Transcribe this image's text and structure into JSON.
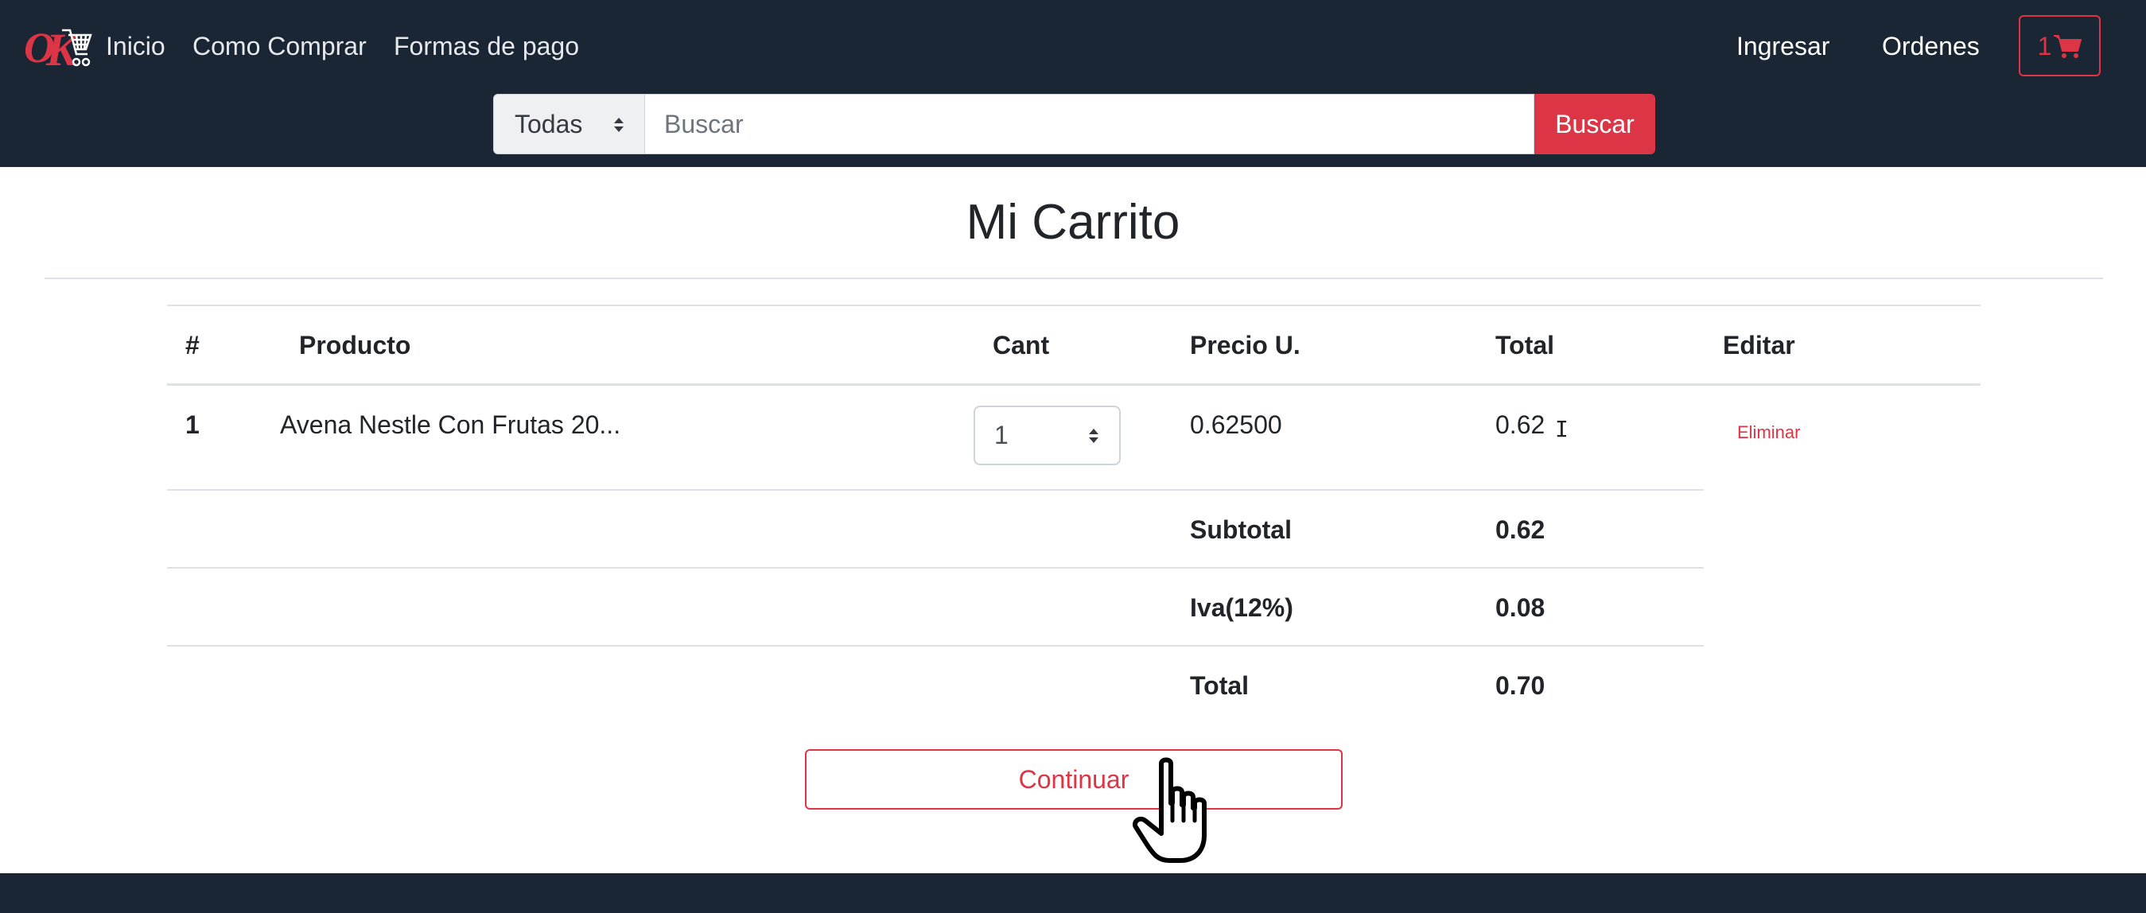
{
  "navbar": {
    "links": [
      "Inicio",
      "Como Comprar",
      "Formas de pago"
    ],
    "right_links": [
      "Ingresar",
      "Ordenes"
    ],
    "cart_count": "1",
    "colors": {
      "background": "#1b2635",
      "accent": "#dc3545"
    }
  },
  "search": {
    "category_selected": "Todas",
    "placeholder": "Buscar",
    "button_label": "Buscar"
  },
  "page": {
    "title": "Mi Carrito"
  },
  "table": {
    "headers": [
      "#",
      "Producto",
      "Cant",
      "Precio U.",
      "Total",
      "Editar"
    ],
    "rows": [
      {
        "index": "1",
        "product": "Avena Nestle Con Frutas 20...",
        "qty": "1",
        "unit_price": "0.62500",
        "total": "0.62",
        "action": "Eliminar"
      }
    ],
    "summary": [
      {
        "label": "Subtotal",
        "value": "0.62"
      },
      {
        "label": "Iva(12%)",
        "value": "0.08"
      },
      {
        "label": "Total",
        "value": "0.70"
      }
    ]
  },
  "actions": {
    "continue_label": "Continuar"
  },
  "icons": {
    "cart": "shopping-cart-icon",
    "cursor": "hand-pointer-icon"
  }
}
